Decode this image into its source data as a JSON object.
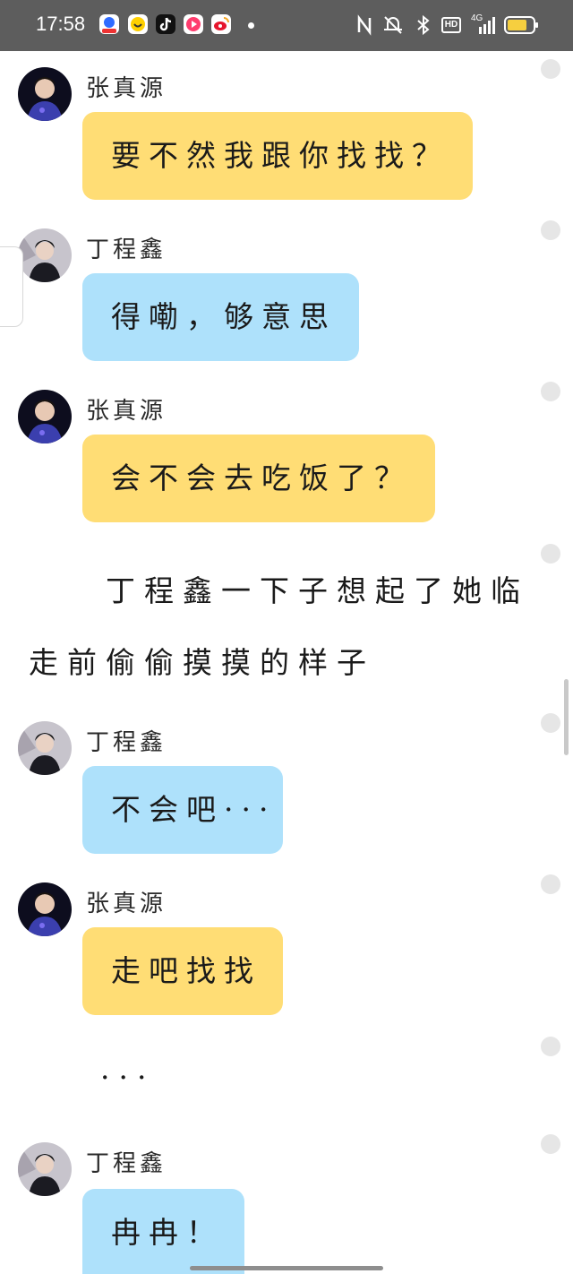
{
  "status_bar": {
    "time": "17:58",
    "apps": [
      "baidu-app-icon",
      "meituan-app-icon",
      "tiktok-app-icon",
      "video-app-icon",
      "weibo-app-icon"
    ],
    "network": "4G",
    "hd": "HD",
    "battery_color": "#f6cf3f"
  },
  "messages": [
    {
      "sender": "张真源",
      "text": "要不然我跟你找找？",
      "color": "yellow"
    },
    {
      "sender": "丁程鑫",
      "text": "得嘞，够意思",
      "color": "blue"
    },
    {
      "sender": "张真源",
      "text": "会不会去吃饭了？",
      "color": "yellow"
    },
    {
      "sender": "丁程鑫",
      "text": "不会吧···",
      "color": "blue"
    },
    {
      "sender": "张真源",
      "text": "走吧找找",
      "color": "yellow"
    },
    {
      "sender": "丁程鑫",
      "text": "冉冉！",
      "color": "blue"
    }
  ],
  "narration": {
    "line1": "丁程鑫一下子想起了她临",
    "line2": "走前偷偷摸摸的样子",
    "ellipsis": "···"
  },
  "colors": {
    "yellow_bubble": "#ffdd75",
    "blue_bubble": "#aee1fb",
    "status_bar": "#5d5d5d"
  }
}
